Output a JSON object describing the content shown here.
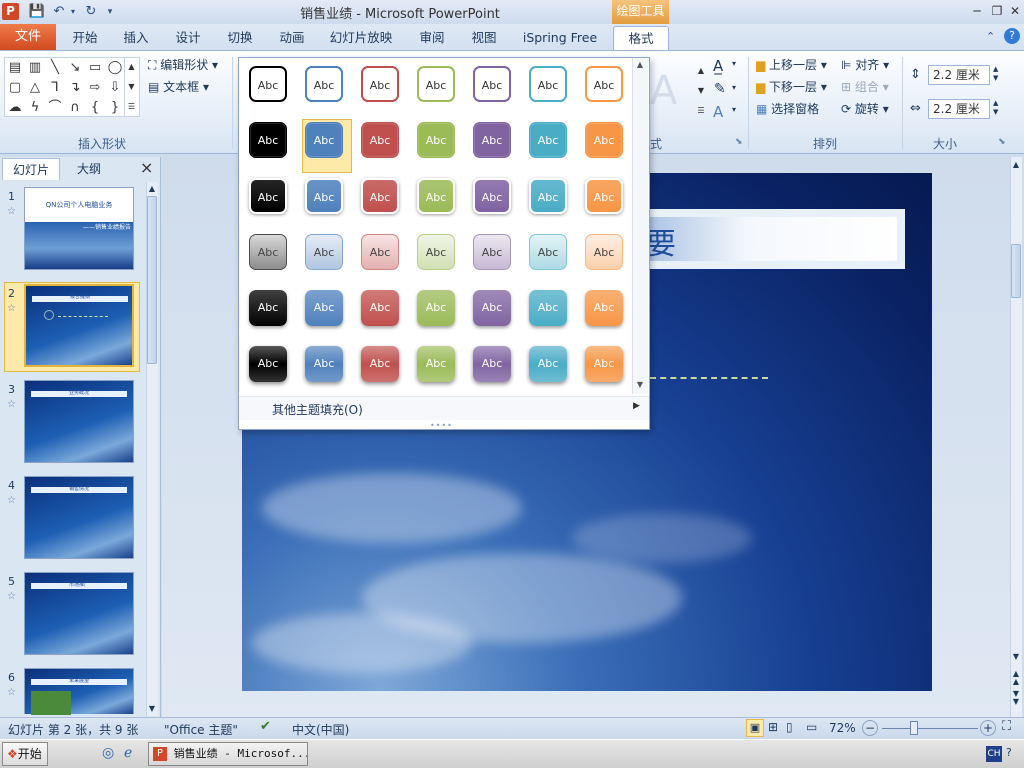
{
  "window": {
    "title": "销售业绩 - Microsoft PowerPoint",
    "logo_letter": "P",
    "contextual_tools": "绘图工具"
  },
  "tabs": [
    "文件",
    "开始",
    "插入",
    "设计",
    "切换",
    "动画",
    "幻灯片放映",
    "审阅",
    "视图",
    "iSpring Free",
    "格式"
  ],
  "active_tab": "格式",
  "ribbon": {
    "insert_shapes": {
      "edit_shape": "编辑形状",
      "text_box": "文本框",
      "label": "插入形状"
    },
    "arrange": {
      "bring_forward": "上移一层",
      "send_backward": "下移一层",
      "selection_pane": "选择窗格",
      "align": "对齐",
      "group": "组合",
      "rotate": "旋转",
      "label": "排列"
    },
    "size": {
      "height": "2.2 厘米",
      "width": "2.2 厘米",
      "label": "大小"
    },
    "partial_group_label": "式"
  },
  "gallery": {
    "swatch_text": "Abc",
    "more_fills": "其他主题填充(O)",
    "colors": [
      "#000000",
      "#4f81bd",
      "#c0504d",
      "#9bbb59",
      "#8064a2",
      "#4bacc6",
      "#f79646"
    ],
    "selected": {
      "row": 1,
      "col": 1
    }
  },
  "left_panel": {
    "tab_slides": "幻灯片",
    "tab_outline": "大纲",
    "close": "×",
    "slides": [
      {
        "num": "1",
        "title": "QN公司个人电脑业务",
        "subtitle": "——销售业绩报告"
      },
      {
        "num": "2",
        "title": "报告提纲"
      },
      {
        "num": "3",
        "title": "业务概况"
      },
      {
        "num": "4",
        "title": "销售情况"
      },
      {
        "num": "5",
        "title": "市场推广"
      },
      {
        "num": "6",
        "title": "未来展望"
      }
    ],
    "selected_slide": "2"
  },
  "slide": {
    "title_partial": "要"
  },
  "status": {
    "slide_info": "幻灯片 第 2 张，共 9 张",
    "theme": "\"Office 主题\"",
    "language": "中文(中国)",
    "zoom": "72%"
  },
  "taskbar": {
    "start": "开始",
    "app": "销售业绩 - Microsof...",
    "lang": "CH"
  }
}
